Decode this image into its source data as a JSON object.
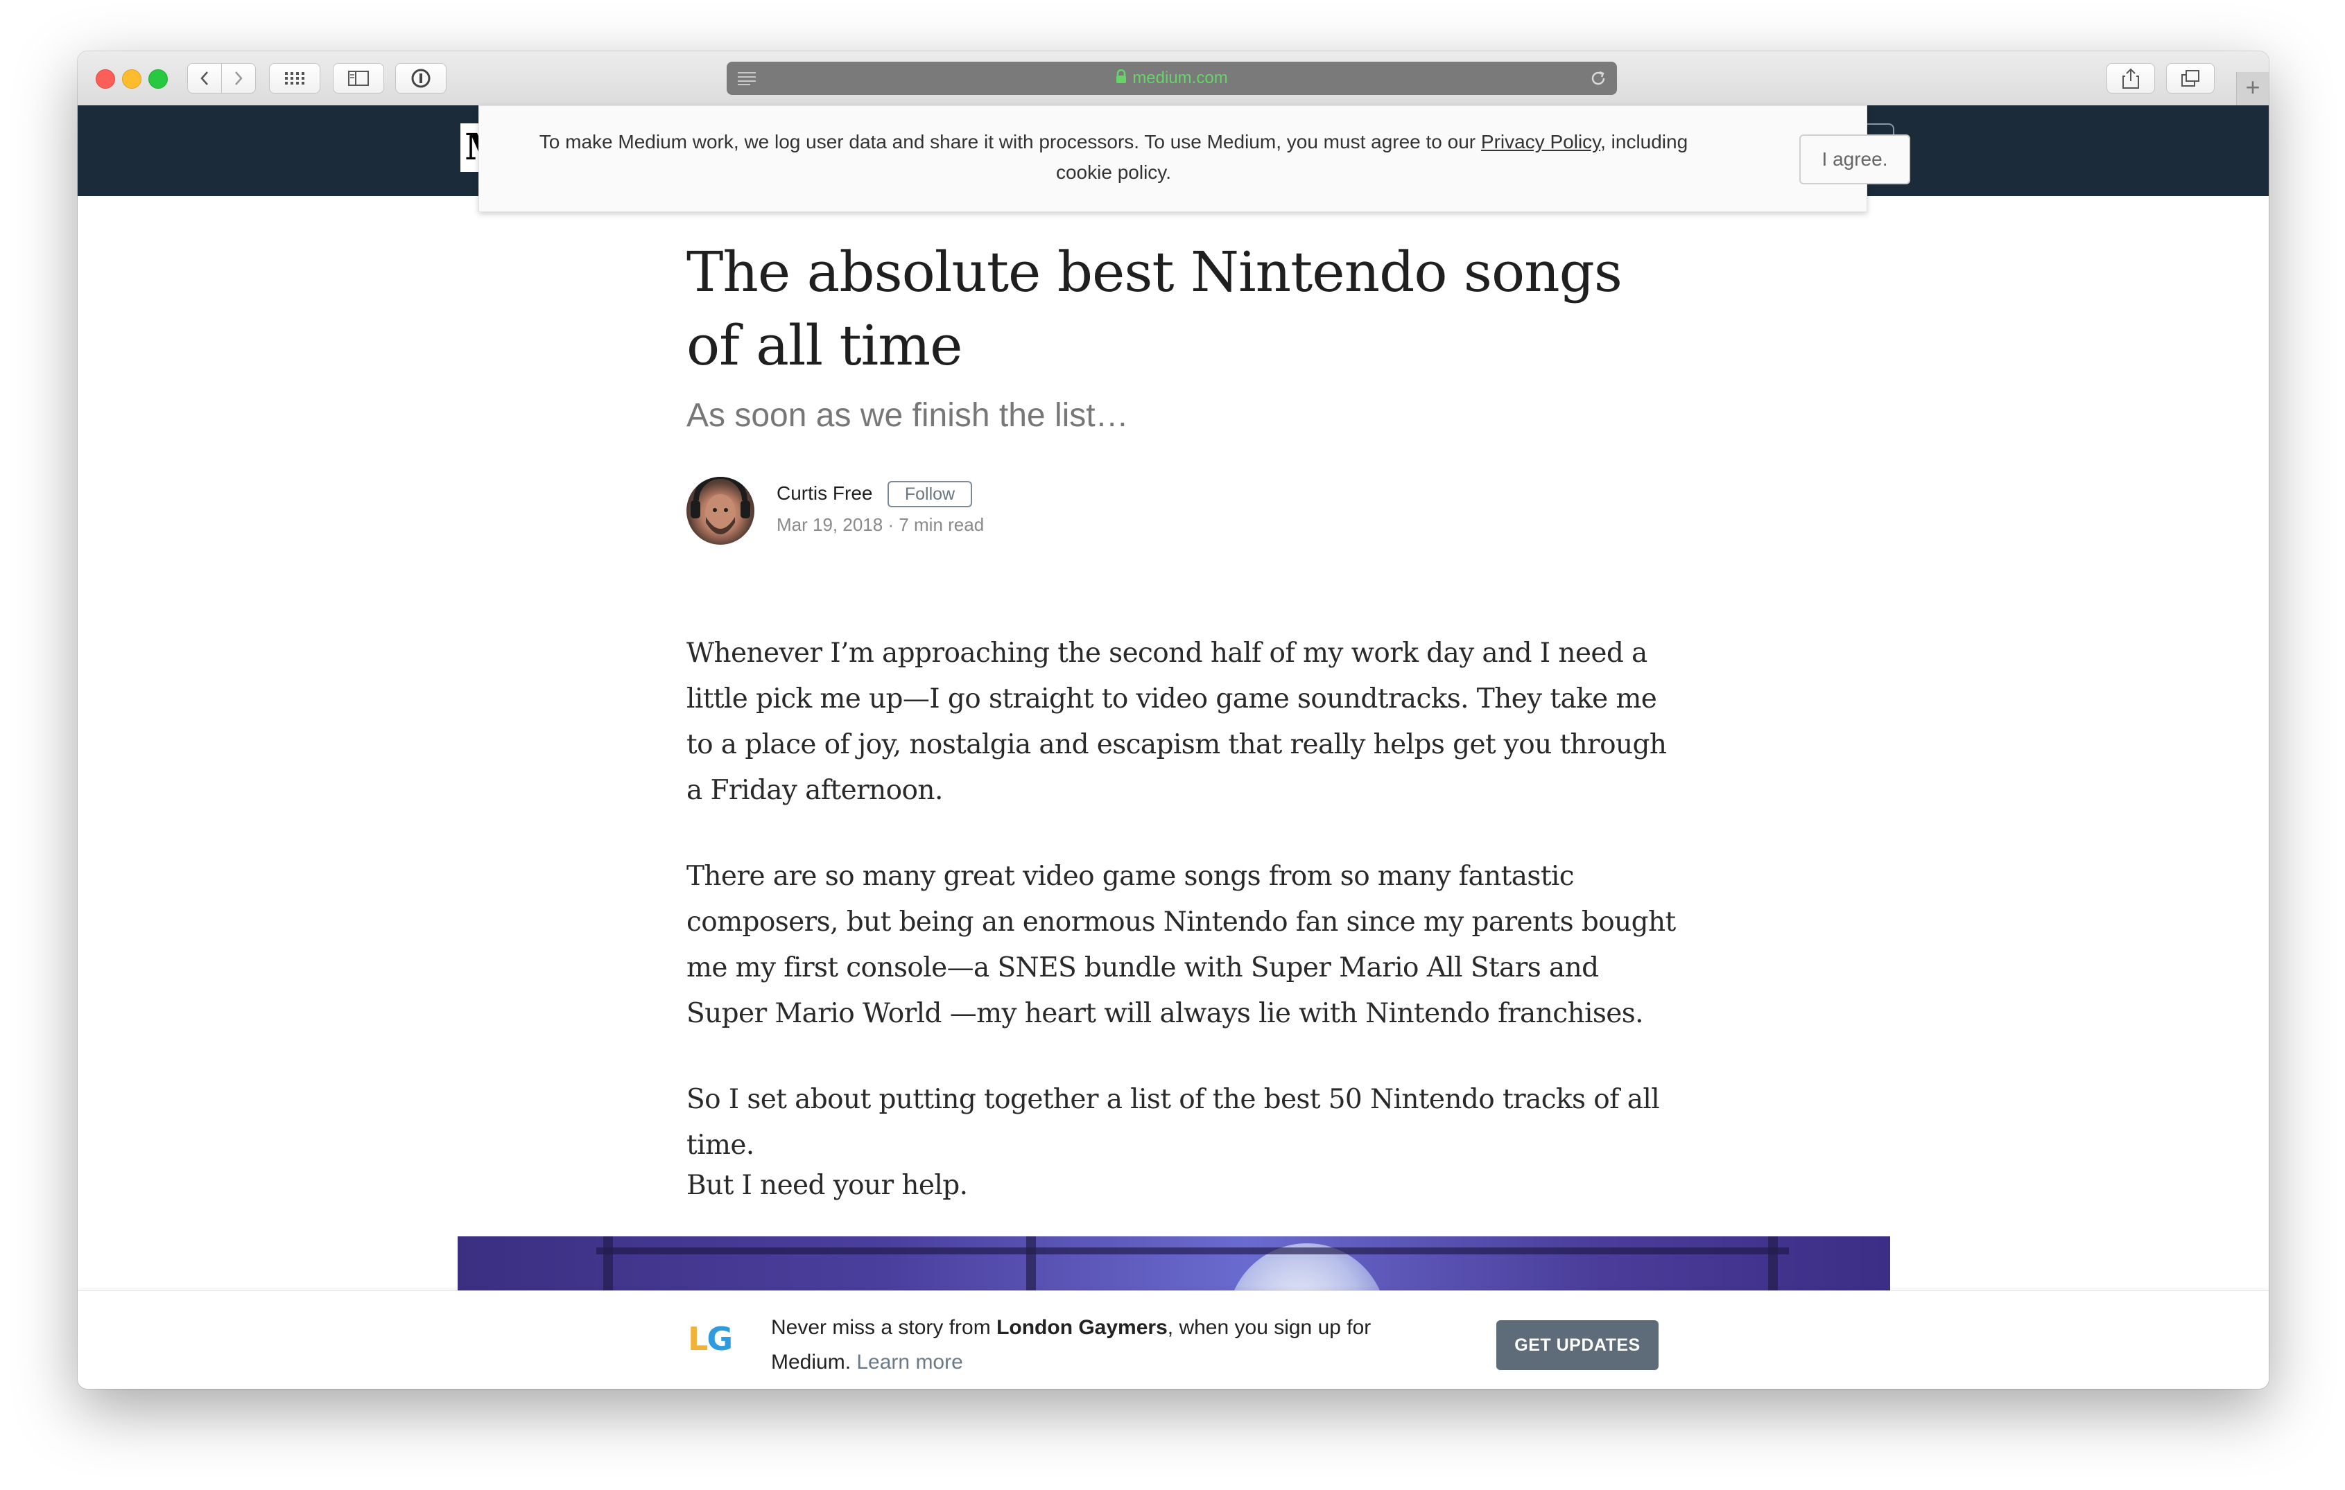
{
  "browser": {
    "url": "medium.com",
    "new_tab_symbol": "+"
  },
  "site": {
    "logo_letter": "M"
  },
  "consent": {
    "text_before_link": "To make Medium work, we log user data and share it with processors. To use Medium, you must agree to our ",
    "link_text": "Privacy Policy",
    "text_after_link": ", including cookie policy.",
    "agree_label": "I agree."
  },
  "article": {
    "title": "The absolute best Nintendo songs of all time",
    "subtitle": "As soon as we finish the list…",
    "author": "Curtis Free",
    "follow_label": "Follow",
    "date": "Mar 19, 2018",
    "separator": " · ",
    "read_time": "7 min read",
    "paragraphs": [
      "Whenever I’m approaching the second half of my work day and I need a little pick me up—I go straight to video game soundtracks. They take me to a place of joy, nostalgia and escapism that really helps get you through a Friday afternoon.",
      "There are so many great video game songs from so many fantastic composers, but being an enormous Nintendo fan since my parents bought me my first console—a SNES bundle with Super Mario All Stars and Super Mario World —my heart will always lie with Nintendo franchises.",
      "So I set about putting together a list of the best 50 Nintendo tracks of all time.",
      "But I need your help."
    ]
  },
  "signup_bar": {
    "logo_l": "L",
    "logo_g": "G",
    "text_before": "Never miss a story from ",
    "publication": "London Gaymers",
    "text_after": ", when you sign up for Medium. ",
    "learn_more": "Learn more",
    "button_label": "GET UPDATES"
  },
  "colors": {
    "header_bg": "#1c2b39",
    "url_green": "#67d46a",
    "button_gray": "#5e6c79"
  }
}
